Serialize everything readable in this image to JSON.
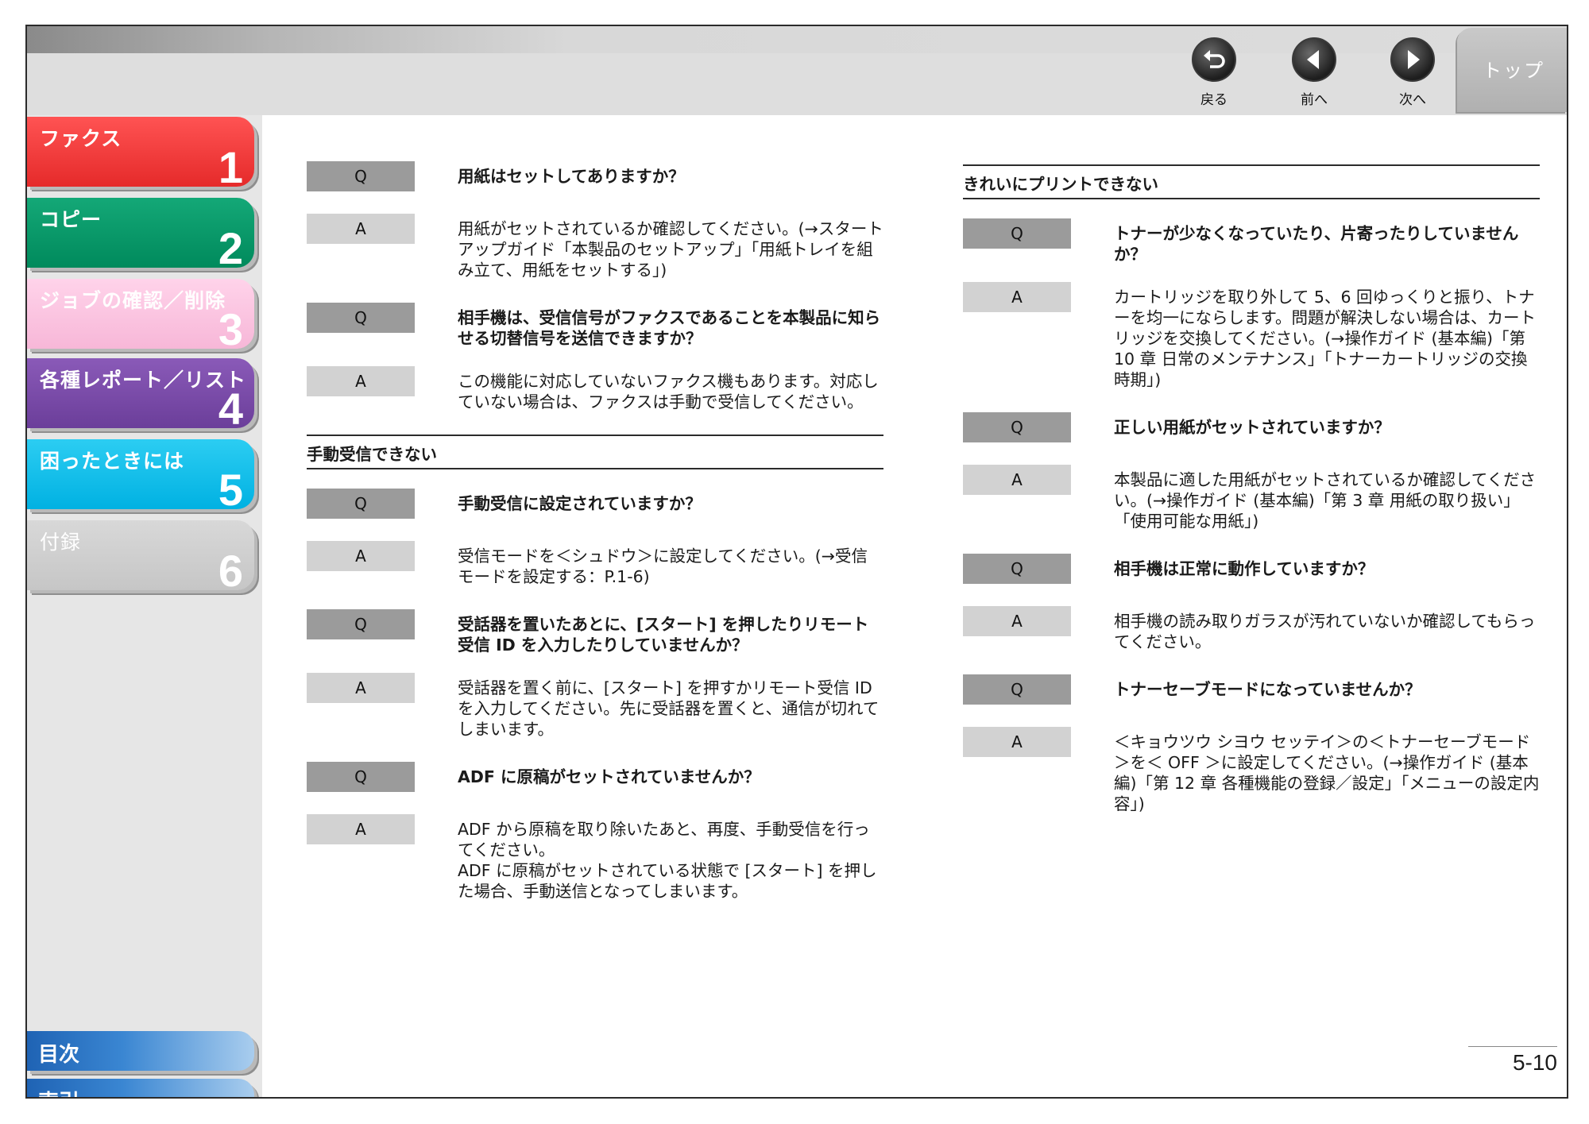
{
  "nav": {
    "back": "戻る",
    "prev": "前へ",
    "next": "次へ",
    "top": "トップ"
  },
  "chapters": [
    {
      "title": "ファクス",
      "number": "1"
    },
    {
      "title": "コピー",
      "number": "2"
    },
    {
      "title": "ジョブの確認／削除",
      "number": "3"
    },
    {
      "title": "各種レポート／リスト",
      "number": "4"
    },
    {
      "title": "困ったときには",
      "number": "5"
    },
    {
      "title": "付録",
      "number": "6"
    }
  ],
  "sidebar_bottom": {
    "toc": "目次",
    "index": "索引"
  },
  "badges": {
    "q": "Q",
    "a": "A"
  },
  "left": {
    "qa1": {
      "q": "用紙はセットしてありますか？",
      "a": "用紙がセットされているか確認してください。(→スタートアップガイド「本製品のセットアップ」「用紙トレイを組み立て、用紙をセットする」)"
    },
    "qa2": {
      "q": "相手機は、受信信号がファクスであることを本製品に知らせる切替信号を送信できますか？",
      "a": "この機能に対応していないファクス機もあります。対応していない場合は、ファクスは手動で受信してください。"
    },
    "section": "手動受信できない",
    "qa3": {
      "q": "手動受信に設定されていますか？",
      "a": "受信モードを＜シュドウ＞に設定してください。(→受信モードを設定する：P.1-6)"
    },
    "qa4": {
      "q": "受話器を置いたあとに、[スタート] を押したりリモート受信 ID を入力したりしていませんか？",
      "a": "受話器を置く前に、[スタート] を押すかリモート受信 ID を入力してください。先に受話器を置くと、通信が切れてしまいます。"
    },
    "qa5": {
      "q": "ADF に原稿がセットされていませんか？",
      "a1": "ADF から原稿を取り除いたあと、再度、手動受信を行ってください。",
      "a2": "ADF に原稿がセットされている状態で [スタート] を押した場合、手動送信となってしまいます。"
    }
  },
  "right": {
    "section": "きれいにプリントできない",
    "qa1": {
      "q": "トナーが少なくなっていたり、片寄ったりしていませんか？",
      "a": "カートリッジを取り外して 5、6 回ゆっくりと振り、トナーを均一にならします。問題が解決しない場合は、カートリッジを交換してください。(→操作ガイド (基本編)「第 10 章 日常のメンテナンス」「トナーカートリッジの交換時期」)"
    },
    "qa2": {
      "q": "正しい用紙がセットされていますか？",
      "a": "本製品に適した用紙がセットされているか確認してください。(→操作ガイド (基本編)「第 3 章 用紙の取り扱い」「使用可能な用紙」)"
    },
    "qa3": {
      "q": "相手機は正常に動作していますか？",
      "a": "相手機の読み取りガラスが汚れていないか確認してもらってください。"
    },
    "qa4": {
      "q": "トナーセーブモードになっていませんか？",
      "a": "＜キョウツウ シヨウ セッテイ＞の＜トナーセーブモード＞を＜ OFF ＞に設定してください。(→操作ガイド (基本編)「第 12 章 各種機能の登録／設定」「メニューの設定内容」)"
    }
  },
  "page_number": "5-10"
}
